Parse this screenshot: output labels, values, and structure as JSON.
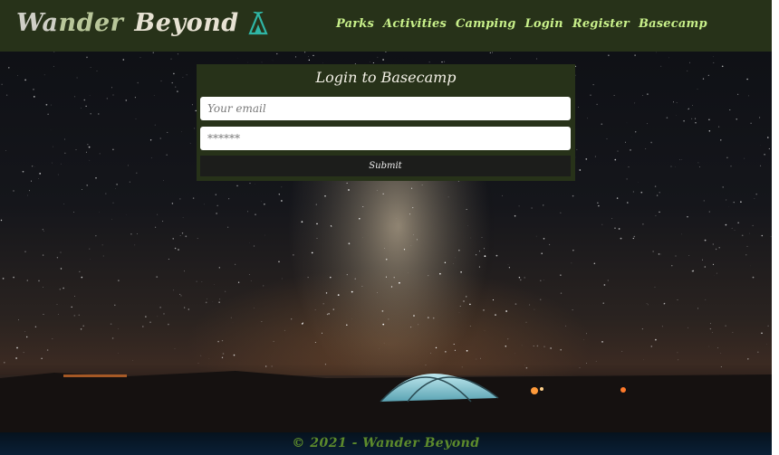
{
  "brand": {
    "part1": "Wa",
    "part2": "nder",
    "part3": "Beyond",
    "logo_icon": "tipi-icon"
  },
  "nav": {
    "links": [
      "Parks",
      "Activities",
      "Camping",
      "Login",
      "Register",
      "Basecamp"
    ]
  },
  "login": {
    "title": "Login to Basecamp",
    "email_placeholder": "Your email",
    "password_placeholder": "******",
    "submit_label": "Submit"
  },
  "footer": {
    "text": "© 2021 - Wander Beyond"
  },
  "colors": {
    "navbar_bg": "#273219",
    "nav_link": "#c8f08a",
    "card_bg": "#273219",
    "submit_bg": "#1c1d1b",
    "footer_text": "#5d8b2c"
  }
}
